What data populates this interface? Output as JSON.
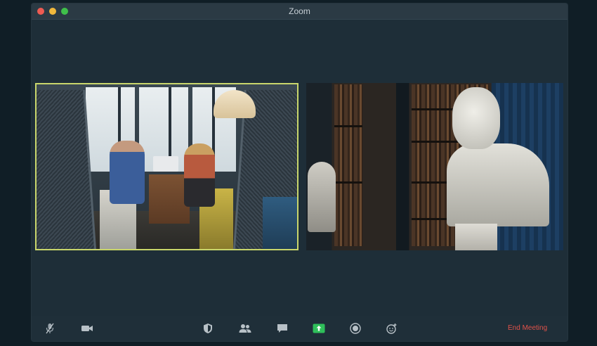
{
  "window": {
    "title": "Zoom"
  },
  "toolbar": {
    "icons": [
      "mic-icon",
      "video-camera-icon",
      "security-shield-icon",
      "participants-icon",
      "chat-icon",
      "share-screen-icon",
      "record-icon",
      "reactions-icon"
    ],
    "end_meeting_label": "End Meeting"
  },
  "colors": {
    "active_speaker_border": "#c9d66b",
    "end_meeting": "#e0524a",
    "share_screen": "#2fbf5a"
  }
}
